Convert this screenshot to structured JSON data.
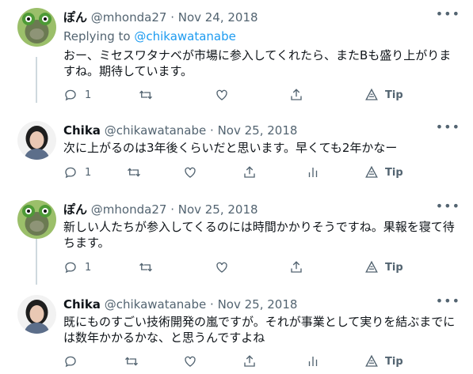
{
  "tweets": [
    {
      "name": "ぽん",
      "handle": "@mhonda27",
      "date": "· Nov 24, 2018",
      "replying_label": "Replying to",
      "replying_handle": "@chikawatanabe",
      "text": "おー、ミセスワタナベが市場に参入してくれたら、またBも盛り上がりますね。期待しています。",
      "replies": "1",
      "tip_label": "Tip",
      "avatar": "frog-cat-avatar"
    },
    {
      "name": "Chika",
      "handle": "@chikawatanabe",
      "date": "· Nov 25, 2018",
      "text": "次に上がるのは3年後くらいだと思います。早くても2年かなー",
      "replies": "1",
      "tip_label": "Tip",
      "avatar": "woman-portrait-avatar"
    },
    {
      "name": "ぽん",
      "handle": "@mhonda27",
      "date": "· Nov 25, 2018",
      "text": "新しい人たちが参入してくるのには時間かかりそうですね。果報を寝て待ちます。",
      "replies": "1",
      "tip_label": "Tip",
      "avatar": "frog-cat-avatar"
    },
    {
      "name": "Chika",
      "handle": "@chikawatanabe",
      "date": "· Nov 25, 2018",
      "text": "既にものすごい技術開発の嵐ですが。それが事業として実りを結ぶまでには数年かかるかな、と思うんですよね",
      "replies": "",
      "tip_label": "Tip",
      "avatar": "woman-portrait-avatar"
    }
  ],
  "icons": {
    "reply": "reply-icon",
    "retweet": "retweet-icon",
    "like": "like-icon",
    "share": "share-icon",
    "analytics": "analytics-icon",
    "tip": "tip-icon",
    "more": "more-icon"
  },
  "colors": {
    "link": "#1d9bf0",
    "muted": "#536471",
    "text": "#0f1419",
    "thread_line": "#cfd9de"
  }
}
